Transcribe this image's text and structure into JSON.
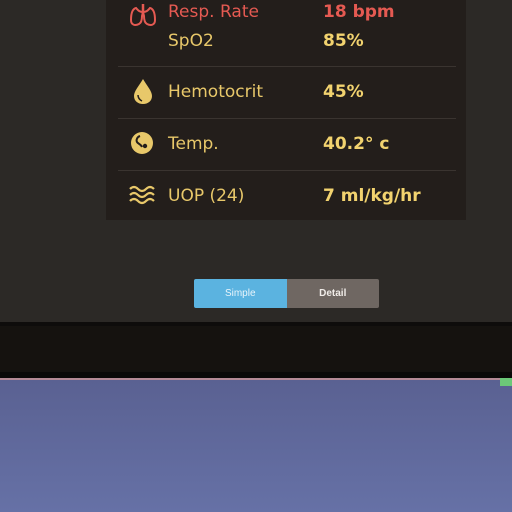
{
  "vitals": [
    {
      "label": "Resp. Rate",
      "value": "18 bpm",
      "icon": "lungs-icon",
      "color": "#e55a52"
    },
    {
      "label": "SpO2",
      "value": "85%",
      "icon": "",
      "color": "#e8c86a"
    },
    {
      "label": "Hemotocrit",
      "value": "45%",
      "icon": "blood-drop-icon",
      "color": "#e8c86a"
    },
    {
      "label": "Temp.",
      "value": "40.2° c",
      "icon": "thermometer-icon",
      "color": "#e8c86a"
    },
    {
      "label": "UOP (24)",
      "value": "7 ml/kg/hr",
      "icon": "waves-icon",
      "color": "#e8c86a"
    }
  ],
  "view_toggle": {
    "simple_label": "Simple",
    "detail_label": "Detail",
    "selected": "Simple"
  },
  "colors": {
    "accent_blue": "#5bb3e0",
    "alert_red": "#e55a52",
    "value_yellow": "#f2d36f"
  }
}
